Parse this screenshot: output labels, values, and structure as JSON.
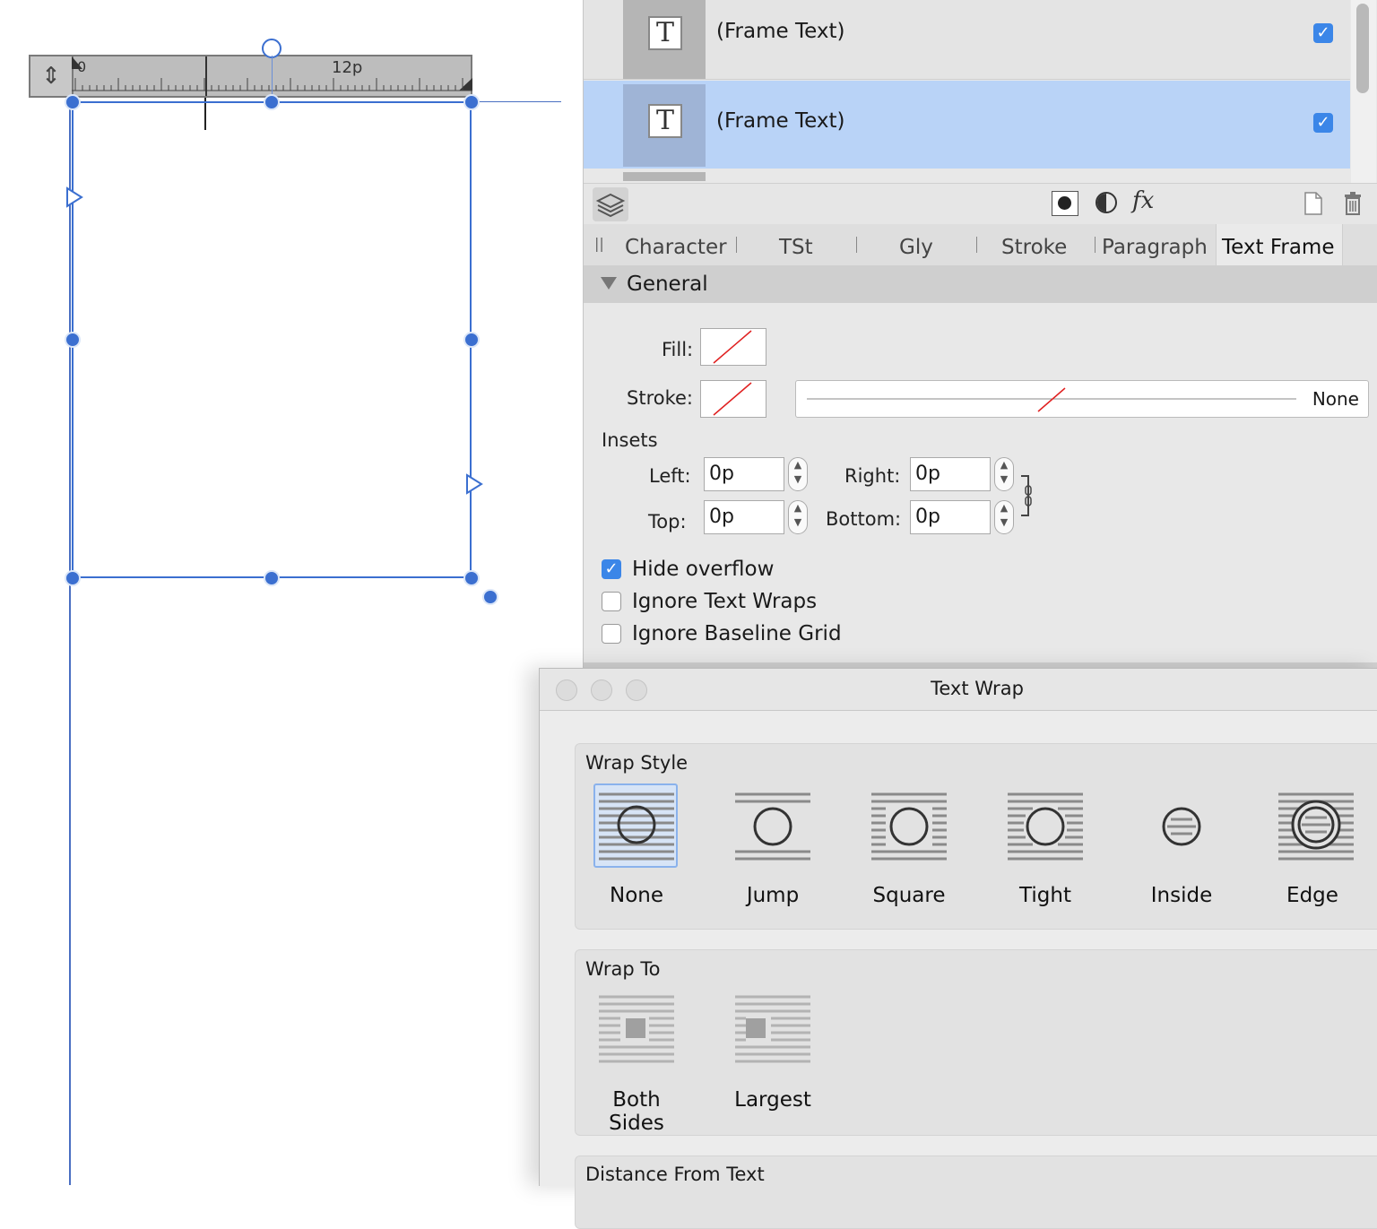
{
  "canvas": {
    "ruler": {
      "label": "12p",
      "handle_icon": "vertical-resize-icon"
    }
  },
  "layers": {
    "rows": [
      {
        "name": "(Frame Text)",
        "visible": true,
        "selected": false,
        "icon": "text-frame-icon"
      },
      {
        "name": "(Frame Text)",
        "visible": true,
        "selected": true,
        "icon": "text-frame-icon"
      }
    ],
    "toolbar_icons": [
      "layers-icon",
      "mask-icon",
      "adjustment-icon",
      "fx-icon",
      "new-page-icon",
      "trash-icon"
    ],
    "fx_label": "fx"
  },
  "tabs": {
    "items": [
      "Character",
      "TSt",
      "Gly",
      "Stroke",
      "Paragraph",
      "Text Frame"
    ],
    "active": "Text Frame"
  },
  "general": {
    "section_title": "General",
    "fill_label": "Fill:",
    "stroke_label": "Stroke:",
    "stroke_style_value": "None",
    "insets_label": "Insets",
    "left_label": "Left:",
    "left_value": "0p",
    "right_label": "Right:",
    "right_value": "0p",
    "top_label": "Top:",
    "top_value": "0p",
    "bottom_label": "Bottom:",
    "bottom_value": "0p",
    "hide_overflow_label": "Hide overflow",
    "hide_overflow": true,
    "ignore_text_wraps_label": "Ignore Text Wraps",
    "ignore_text_wraps": false,
    "ignore_baseline_grid_label": "Ignore Baseline Grid",
    "ignore_baseline_grid": false
  },
  "text_wrap": {
    "title": "Text Wrap",
    "wrap_style_title": "Wrap Style",
    "styles": [
      "None",
      "Jump",
      "Square",
      "Tight",
      "Inside",
      "Edge"
    ],
    "selected_style": "None",
    "wrap_to_title": "Wrap To",
    "wrap_to": [
      "Both Sides",
      "Largest"
    ],
    "distance_title": "Distance From Text"
  },
  "colors": {
    "accent": "#3b86e8",
    "selection_row": "#b9d3f7",
    "handle": "#3b6fd0"
  }
}
